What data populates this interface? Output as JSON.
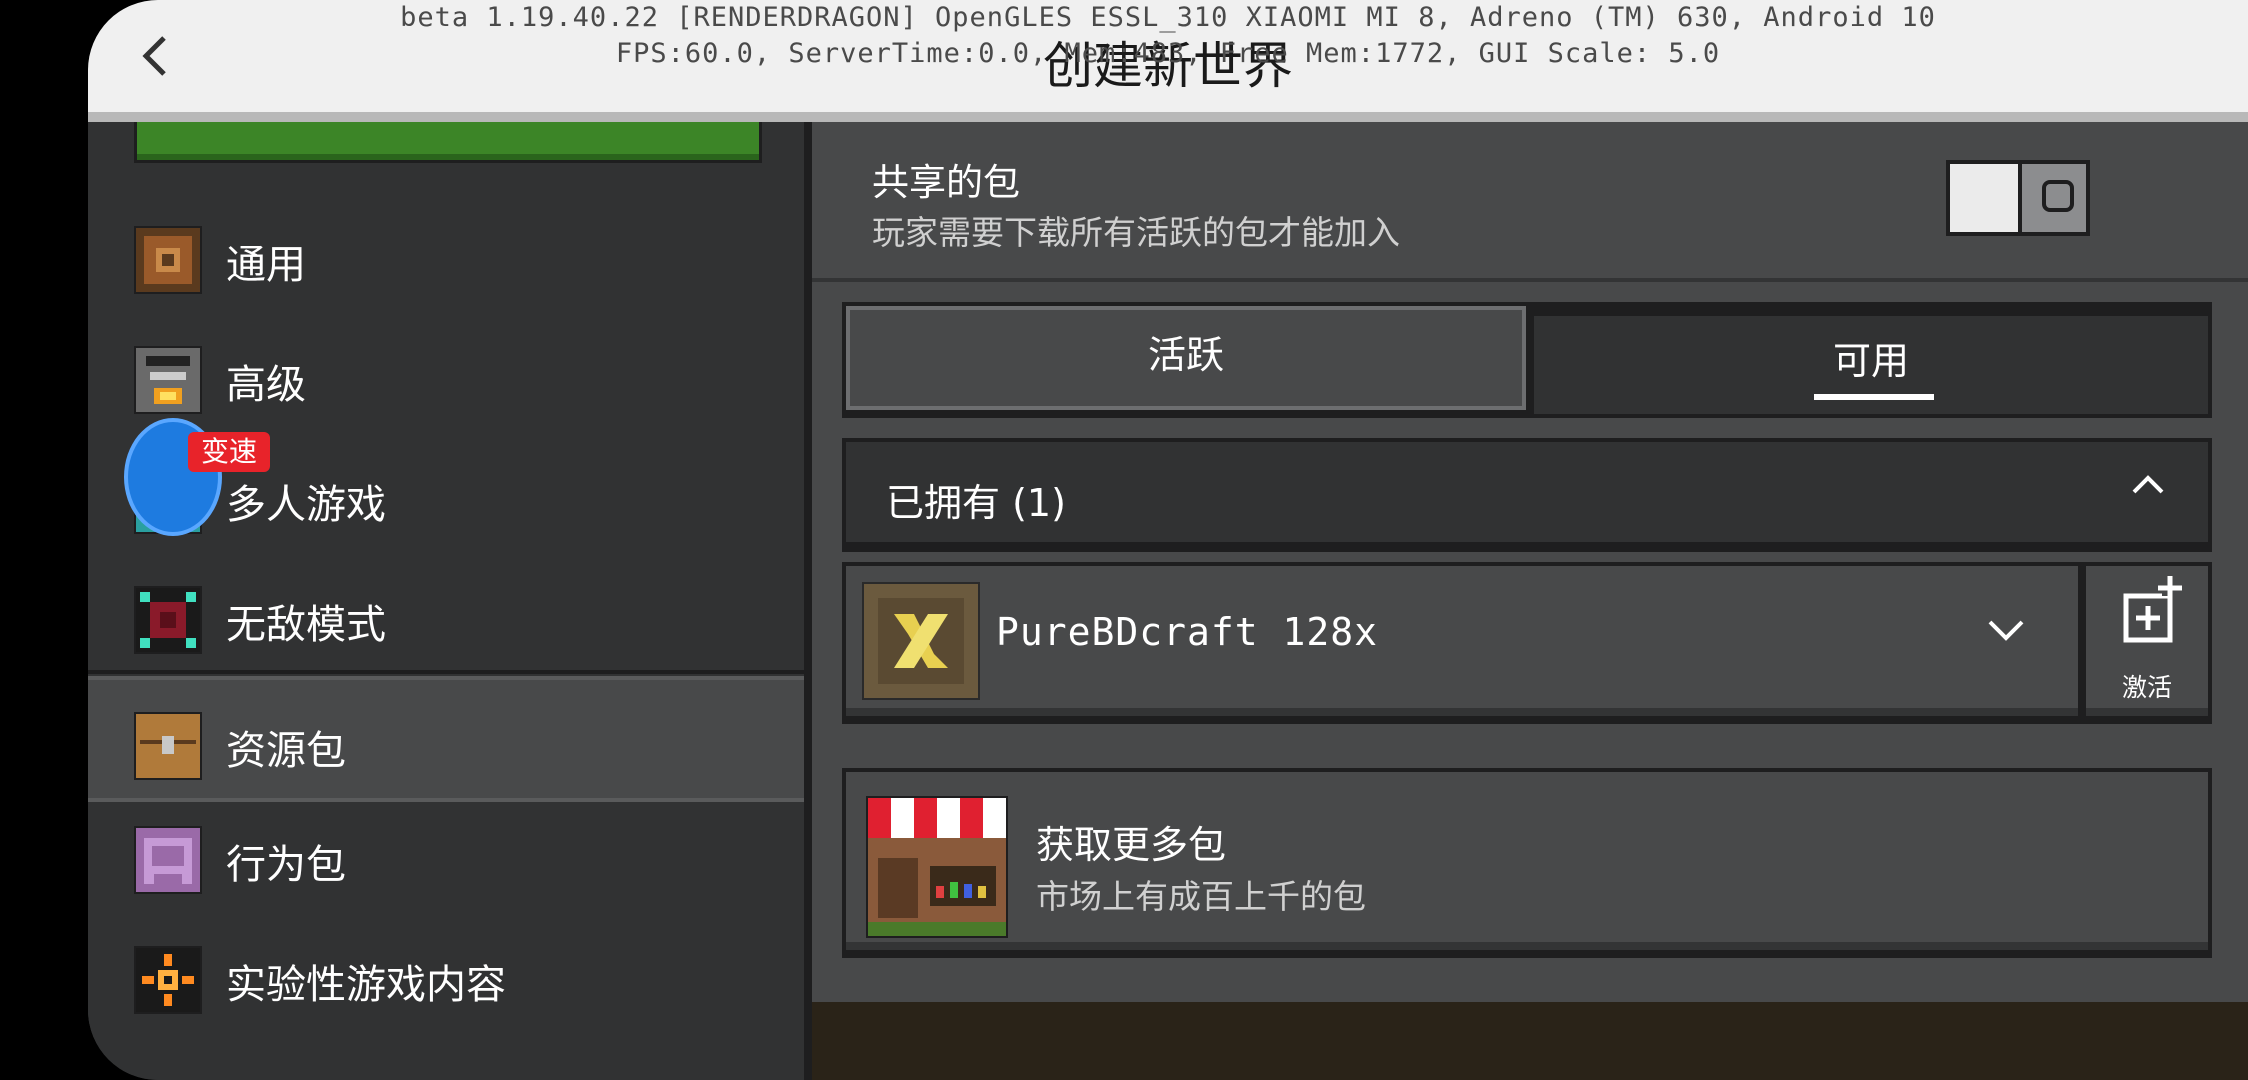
{
  "header": {
    "title": "创建新世界",
    "back_icon": "chevron-left-icon",
    "debug_line1": "beta 1.19.40.22 [RENDERDRAGON] OpenGLES ESSL_310 XIAOMI MI 8, Adreno (TM) 630, Android 10",
    "debug_line2": "FPS:60.0, ServerTime:0.0, Mem:483, Free Mem:1772, GUI Scale: 5.0"
  },
  "sidebar": {
    "items": [
      {
        "label": "通用",
        "icon": "gear-icon"
      },
      {
        "label": "高级",
        "icon": "furnace-icon"
      },
      {
        "label": "多人游戏",
        "icon": "players-icon"
      },
      {
        "label": "无敌模式",
        "icon": "creative-icon"
      },
      {
        "label": "资源包",
        "icon": "chest-icon",
        "active": true
      },
      {
        "label": "行为包",
        "icon": "behavior-icon"
      },
      {
        "label": "实验性游戏内容",
        "icon": "experimental-icon"
      }
    ],
    "speed_badge": "变速"
  },
  "main": {
    "shared": {
      "title": "共享的包",
      "subtitle": "玩家需要下载所有活跃的包才能加入",
      "toggle_on": false
    },
    "tabs": [
      {
        "label": "活跃"
      },
      {
        "label": "可用",
        "selected": true
      }
    ],
    "owned": {
      "label": "已拥有 (1)",
      "expand_icon": "chevron-up-icon"
    },
    "pack": {
      "name": "PureBDcraft 128x",
      "activate_label": "激活"
    },
    "more": {
      "title": "获取更多包",
      "subtitle": "市场上有成百上千的包"
    }
  }
}
